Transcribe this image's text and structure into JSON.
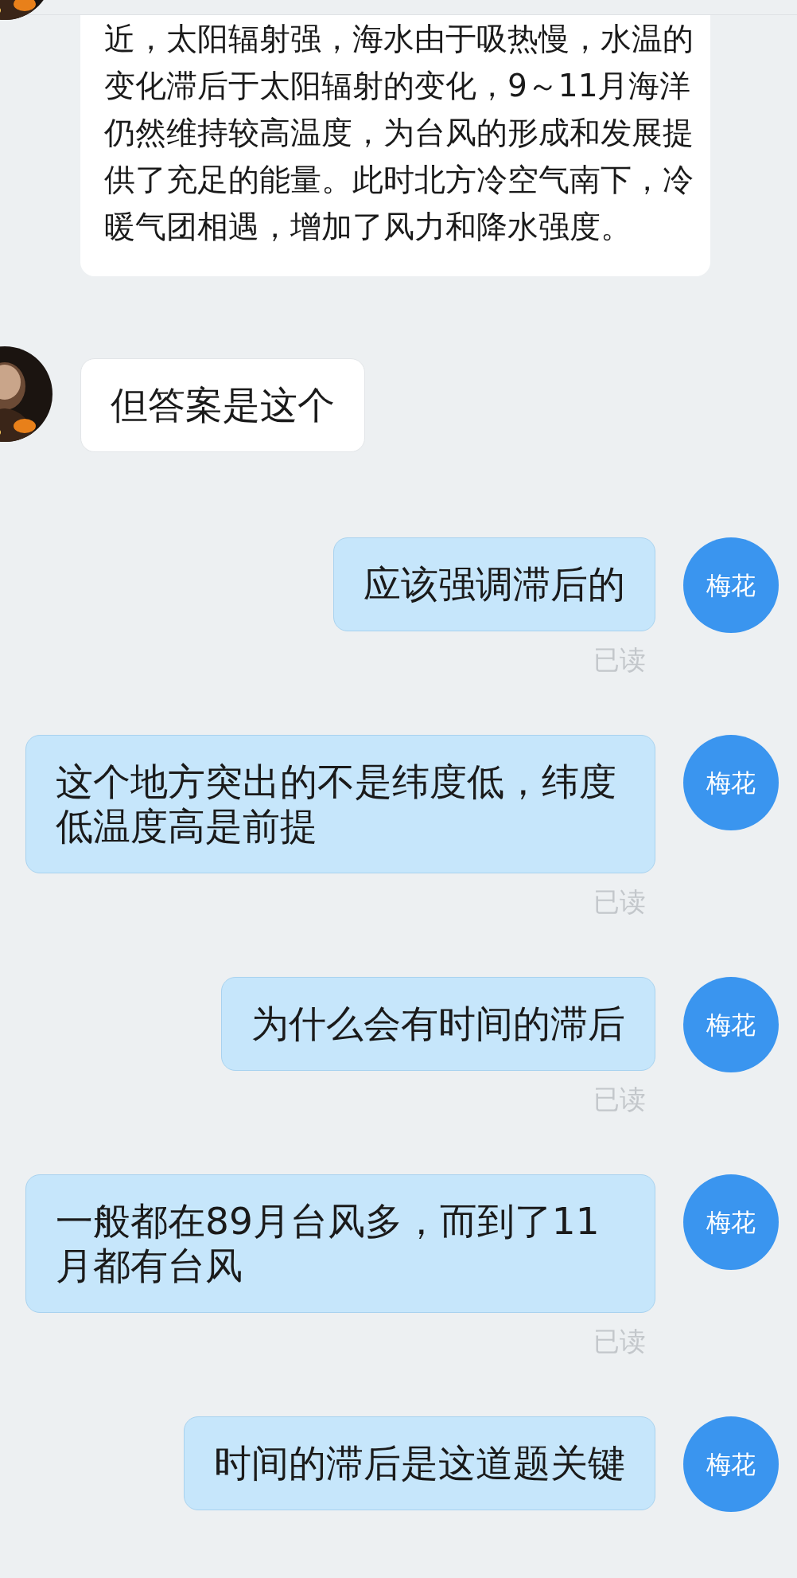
{
  "messages": [
    {
      "kind": "received",
      "cut_off": true,
      "text": "近，太阳辐射强，海水由于吸热慢，水温的变化滞后于太阳辐射的变化，9～11月海洋仍然维持较高温度，为台风的形成和发展提供了充足的能量。此时北方冷空气南下，冷暖气团相遇，增加了风力和降水强度。"
    },
    {
      "kind": "received",
      "cut_off": false,
      "text": "但答案是这个"
    },
    {
      "kind": "sent",
      "avatar_label": "梅花",
      "text": "应该强调滞后的",
      "receipt": "已读"
    },
    {
      "kind": "sent",
      "avatar_label": "梅花",
      "text": "这个地方突出的不是纬度低，纬度低温度高是前提",
      "receipt": "已读"
    },
    {
      "kind": "sent",
      "avatar_label": "梅花",
      "text": "为什么会有时间的滞后",
      "receipt": "已读"
    },
    {
      "kind": "sent",
      "avatar_label": "梅花",
      "text": "一般都在89月台风多，而到了11月都有台风",
      "receipt": "已读"
    },
    {
      "kind": "sent",
      "avatar_label": "梅花",
      "text": "时间的滞后是这道题关键"
    }
  ]
}
